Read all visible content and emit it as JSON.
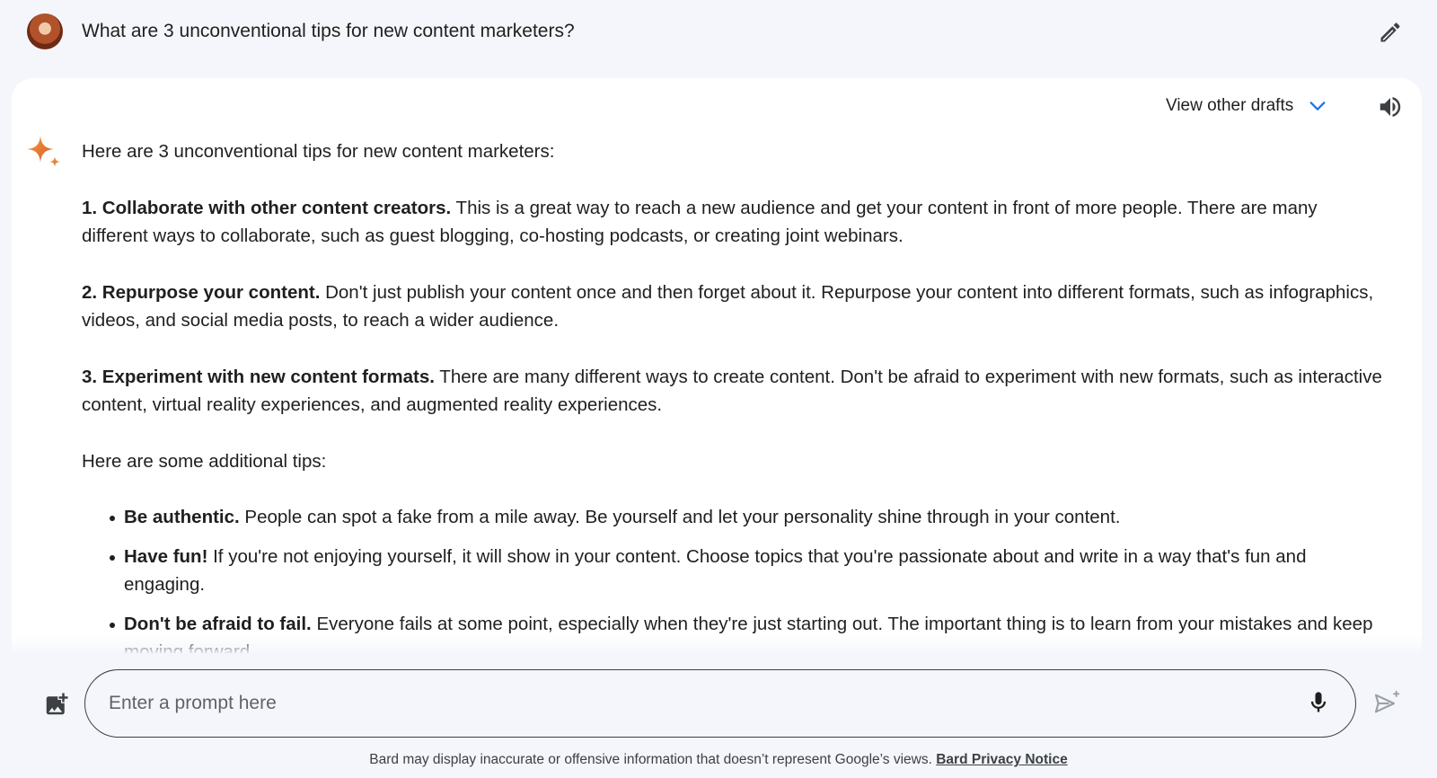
{
  "user_prompt": {
    "avatar": "user-avatar",
    "text": "What are 3 unconventional tips for new content marketers?",
    "edit_icon": "pencil-icon"
  },
  "response": {
    "drafts_label": "View other drafts",
    "drafts_icon": "chevron-down-icon",
    "drafts_icon_color": "#1a73e8",
    "speaker_icon": "volume-icon",
    "assistant_icon": "bard-sparkle-icon",
    "intro": "Here are 3 unconventional tips for new content marketers:",
    "tips": [
      {
        "title": "1. Collaborate with other content creators.",
        "text": " This is a great way to reach a new audience and get your content in front of more people. There are many different ways to collaborate, such as guest blogging, co-hosting podcasts, or creating joint webinars."
      },
      {
        "title": "2. Repurpose your content.",
        "text": " Don't just publish your content once and then forget about it. Repurpose your content into different formats, such as infographics, videos, and social media posts, to reach a wider audience."
      },
      {
        "title": "3. Experiment with new content formats.",
        "text": " There are many different ways to create content. Don't be afraid to experiment with new formats, such as interactive content, virtual reality experiences, and augmented reality experiences."
      }
    ],
    "additional_heading": "Here are some additional tips:",
    "additional_tips": [
      {
        "title": "Be authentic.",
        "text": " People can spot a fake from a mile away. Be yourself and let your personality shine through in your content."
      },
      {
        "title": "Have fun!",
        "text": " If you're not enjoying yourself, it will show in your content. Choose topics that you're passionate about and write in a way that's fun and engaging."
      },
      {
        "title": "Don't be afraid to fail.",
        "text": " Everyone fails at some point, especially when they're just starting out. The important thing is to learn from your mistakes and keep moving forward."
      }
    ]
  },
  "input_bar": {
    "upload_icon": "add-image-icon",
    "placeholder": "Enter a prompt here",
    "mic_icon": "microphone-icon",
    "send_icon": "send-icon"
  },
  "footer": {
    "disclaimer": "Bard may display inaccurate or offensive information that doesn’t represent Google’s views. ",
    "privacy_link": "Bard Privacy Notice"
  },
  "colors": {
    "page_background": "#f4f6fb",
    "card_background": "#ffffff",
    "text": "#1f1f1f",
    "accent_blue": "#1a73e8"
  }
}
